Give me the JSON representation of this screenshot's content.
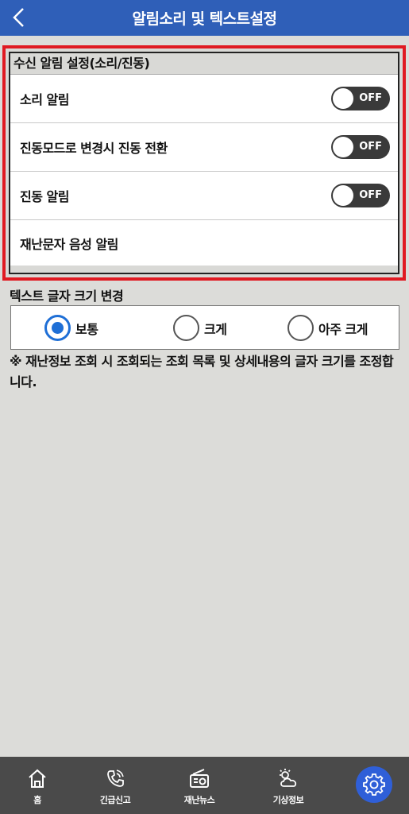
{
  "header": {
    "title": "알림소리 및 텍스트설정",
    "back_icon": "chevron-left-icon"
  },
  "alarm_section": {
    "label": "수신 알림 설정(소리/진동)",
    "items": [
      {
        "label": "소리 알림",
        "toggle": "OFF"
      },
      {
        "label": "진동모드로 변경시 진동 전환",
        "toggle": "OFF"
      },
      {
        "label": "진동 알림",
        "toggle": "OFF"
      },
      {
        "label": "재난문자 음성 알림"
      }
    ]
  },
  "text_section": {
    "label": "텍스트 글자 크기 변경",
    "options": [
      {
        "label": "보통",
        "selected": true
      },
      {
        "label": "크게",
        "selected": false
      },
      {
        "label": "아주 크게",
        "selected": false
      }
    ],
    "note": "※ 재난정보 조회 시 조회되는 조회 목록 및 상세내용의 글자 크기를 조정합니다."
  },
  "bottom_nav": {
    "items": [
      {
        "label": "홈",
        "icon": "home-icon"
      },
      {
        "label": "긴급신고",
        "icon": "phone-icon"
      },
      {
        "label": "재난뉴스",
        "icon": "radio-icon"
      },
      {
        "label": "기상정보",
        "icon": "weather-icon"
      }
    ],
    "settings_icon": "gear-icon"
  },
  "colors": {
    "header_bg": "#2f5fb8",
    "highlight_border": "#e01a22",
    "radio_selected": "#1f6fd6",
    "nav_bg": "#4a4a4a",
    "settings_bg": "#2f5fd8"
  }
}
